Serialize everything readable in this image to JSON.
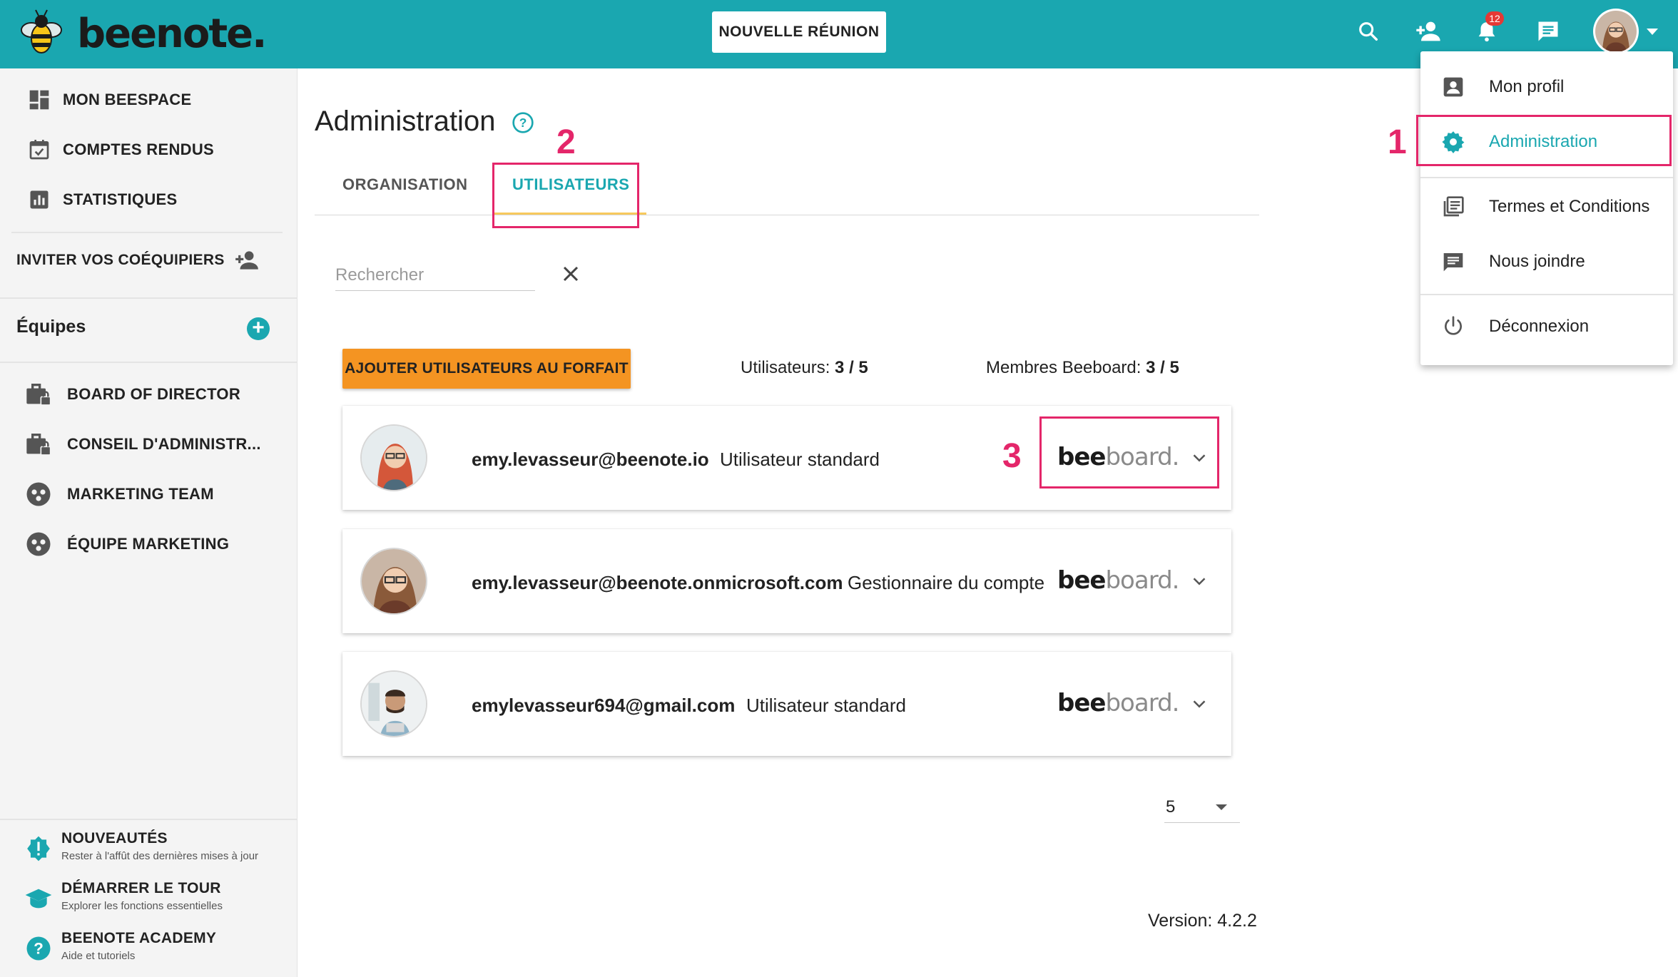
{
  "app": {
    "logo_text": "beenote.",
    "new_meeting_label": "NOUVELLE RÉUNION",
    "notification_count": "12",
    "accent_color": "#1aa7b0",
    "icons": [
      "search-icon",
      "add-user-icon",
      "bell-icon",
      "chat-icon",
      "avatar"
    ]
  },
  "sidebar": {
    "nav": [
      {
        "label": "MON BEESPACE",
        "icon": "dashboard-icon"
      },
      {
        "label": "COMPTES RENDUS",
        "icon": "calendar-check-icon"
      },
      {
        "label": "STATISTIQUES",
        "icon": "bar-chart-icon"
      }
    ],
    "invite_label": "INVITER VOS COÉQUIPIERS",
    "teams_title": "Équipes",
    "teams": [
      {
        "label": "BOARD OF DIRECTOR",
        "icon": "briefcase-lock-icon"
      },
      {
        "label": "CONSEIL D'ADMINISTR...",
        "icon": "briefcase-lock-icon"
      },
      {
        "label": "MARKETING TEAM",
        "icon": "group-icon"
      },
      {
        "label": "ÉQUIPE MARKETING",
        "icon": "group-icon"
      }
    ],
    "footer": [
      {
        "title": "NOUVEAUTÉS",
        "subtitle": "Rester à l'affût des dernières mises à jour",
        "icon": "alert-badge-icon"
      },
      {
        "title": "DÉMARRER LE TOUR",
        "subtitle": "Explorer les fonctions essentielles",
        "icon": "graduation-cap-icon"
      },
      {
        "title": "BEENOTE ACADEMY",
        "subtitle": "Aide et tutoriels",
        "icon": "help-circle-icon"
      }
    ]
  },
  "main": {
    "title": "Administration",
    "tabs": [
      {
        "label": "ORGANISATION",
        "active": false
      },
      {
        "label": "UTILISATEURS",
        "active": true
      }
    ],
    "search_placeholder": "Rechercher",
    "add_users_label": "AJOUTER UTILISATEURS AU FORFAIT",
    "users_count_label": "Utilisateurs:",
    "users_count_value": "3 / 5",
    "beeboard_count_label": "Membres Beeboard:",
    "beeboard_count_value": "3 / 5",
    "users": [
      {
        "email": "emy.levasseur@beenote.io",
        "role": "Utilisateur standard",
        "badge_bold": "bee",
        "badge_light": "board."
      },
      {
        "email": "emy.levasseur@beenote.onmicrosoft.com",
        "role": "Gestionnaire du compte",
        "badge_bold": "bee",
        "badge_light": "board."
      },
      {
        "email": "emylevasseur694@gmail.com",
        "role": "Utilisateur standard",
        "badge_bold": "bee",
        "badge_light": "board."
      }
    ],
    "page_size": "5",
    "version": "Version: 4.2.2"
  },
  "menu": {
    "items": [
      {
        "label": "Mon profil",
        "icon": "account-box-icon"
      },
      {
        "label": "Administration",
        "icon": "gear-icon",
        "active": true
      },
      {
        "label": "Termes et Conditions",
        "icon": "library-books-icon"
      },
      {
        "label": "Nous joindre",
        "icon": "message-icon"
      },
      {
        "label": "Déconnexion",
        "icon": "power-icon"
      }
    ]
  },
  "annotations": [
    "1",
    "2",
    "3"
  ]
}
